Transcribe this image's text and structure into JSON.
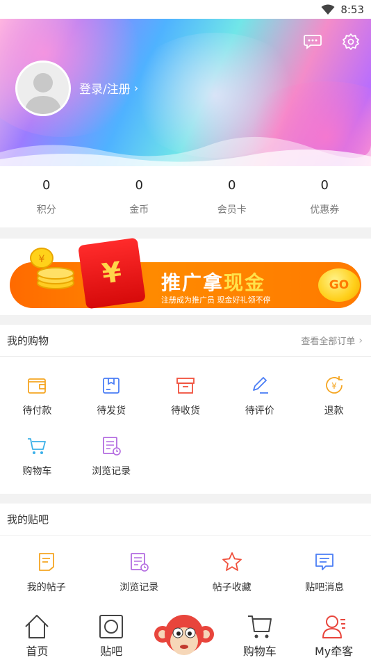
{
  "status_bar": {
    "time": "8:53",
    "wifi_icon": "wifi-icon"
  },
  "header": {
    "message_icon": "chat-bubble-icon",
    "settings_icon": "gear-icon",
    "avatar_icon": "default-avatar-icon",
    "login_label": "登录/注册",
    "chevron": "›"
  },
  "stats": [
    {
      "value": "0",
      "label": "积分"
    },
    {
      "value": "0",
      "label": "金币"
    },
    {
      "value": "0",
      "label": "会员卡"
    },
    {
      "value": "0",
      "label": "优惠券"
    }
  ],
  "banner": {
    "title_white": "推广拿",
    "title_gold": "现金",
    "subtitle": "注册成为推广员  现金好礼领不停",
    "go_label": "GO",
    "envelope_symbol": "¥"
  },
  "shopping": {
    "title": "我的购物",
    "more_label": "查看全部订单",
    "items": [
      {
        "label": "待付款",
        "icon": "wallet-icon",
        "color": "#f5a623"
      },
      {
        "label": "待发货",
        "icon": "package-icon",
        "color": "#4a7df5"
      },
      {
        "label": "待收货",
        "icon": "box-icon",
        "color": "#f0503c"
      },
      {
        "label": "待评价",
        "icon": "pencil-icon",
        "color": "#4a7df5"
      },
      {
        "label": "退款",
        "icon": "refund-icon",
        "color": "#f5a623"
      },
      {
        "label": "购物车",
        "icon": "cart-icon",
        "color": "#3bb0e8"
      },
      {
        "label": "浏览记录",
        "icon": "history-icon",
        "color": "#b36be0"
      }
    ]
  },
  "forum": {
    "title": "我的贴吧",
    "items": [
      {
        "label": "我的帖子",
        "icon": "document-icon",
        "color": "#f5a623"
      },
      {
        "label": "浏览记录",
        "icon": "history-icon",
        "color": "#b36be0"
      },
      {
        "label": "帖子收藏",
        "icon": "star-icon",
        "color": "#f0503c"
      },
      {
        "label": "贴吧消息",
        "icon": "message-icon",
        "color": "#4a7df5"
      }
    ]
  },
  "tabbar": {
    "items": [
      {
        "label": "首页",
        "icon": "home-icon"
      },
      {
        "label": "贴吧",
        "icon": "forum-icon"
      },
      {
        "label": "",
        "icon": "monkey-mascot-icon"
      },
      {
        "label": "购物车",
        "icon": "cart-icon"
      },
      {
        "label": "My牵客",
        "icon": "user-profile-icon"
      }
    ]
  }
}
